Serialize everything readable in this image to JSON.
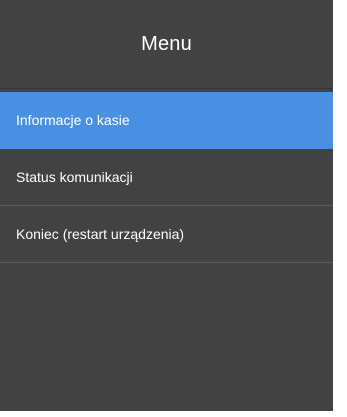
{
  "header": {
    "title": "Menu"
  },
  "menu": {
    "items": [
      {
        "label": "Informacje o kasie",
        "selected": true
      },
      {
        "label": "Status komunikacji",
        "selected": false
      },
      {
        "label": "Koniec (restart urządzenia)",
        "selected": false
      }
    ]
  },
  "colors": {
    "background": "#424242",
    "selected_background": "#4a90e2",
    "text": "#ffffff"
  }
}
